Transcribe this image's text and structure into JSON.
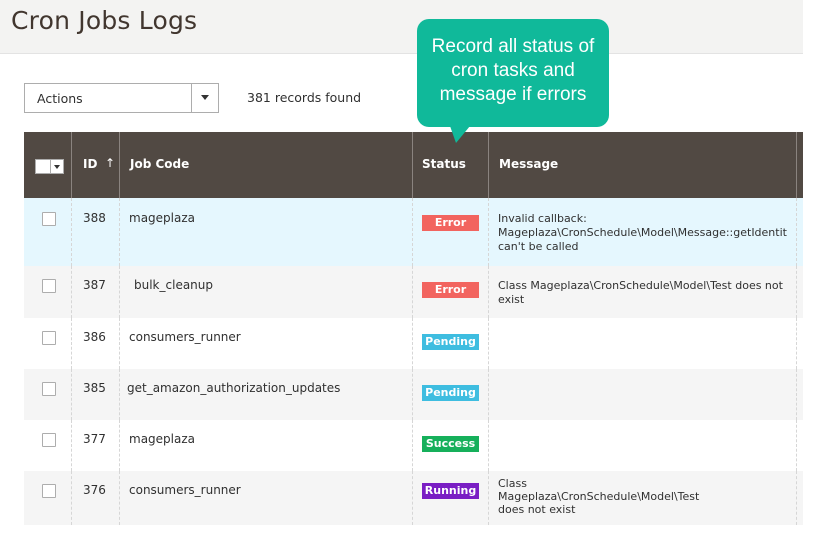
{
  "page": {
    "title": "Cron Jobs Logs"
  },
  "toolbar": {
    "actions_label": "Actions",
    "records_found": "381 records found"
  },
  "tooltip": {
    "lines": [
      "Record all status of",
      "cron tasks and",
      "message if errors"
    ],
    "color": "#10b99a"
  },
  "grid": {
    "columns": {
      "id": "ID",
      "id_sort": "↑",
      "job_code": "Job Code",
      "status": "Status",
      "message": "Message"
    },
    "status_colors": {
      "Error": "#f2645f",
      "Pending": "#3ebde0",
      "Success": "#16b05b",
      "Running": "#7a1ec4"
    },
    "rows": [
      {
        "id": "388",
        "job_code": "mageplaza",
        "status": "Error",
        "message": [
          "Invalid callback:",
          "Mageplaza\\CronSchedule\\Model\\Message::getIdentit",
          "can't be called"
        ]
      },
      {
        "id": "387",
        "job_code": "bulk_cleanup",
        "status": "Error",
        "message": [
          "Class Mageplaza\\CronSchedule\\Model\\Test does not",
          "exist"
        ]
      },
      {
        "id": "386",
        "job_code": "consumers_runner",
        "status": "Pending",
        "message": []
      },
      {
        "id": "385",
        "job_code": "get_amazon_authorization_updates",
        "status": "Pending",
        "message": []
      },
      {
        "id": "377",
        "job_code": "mageplaza",
        "status": "Success",
        "message": []
      },
      {
        "id": "376",
        "job_code": "consumers_runner",
        "status": "Running",
        "message": [
          "Class",
          "Mageplaza\\CronSchedule\\Model\\Test",
          "does not exist"
        ]
      }
    ]
  }
}
